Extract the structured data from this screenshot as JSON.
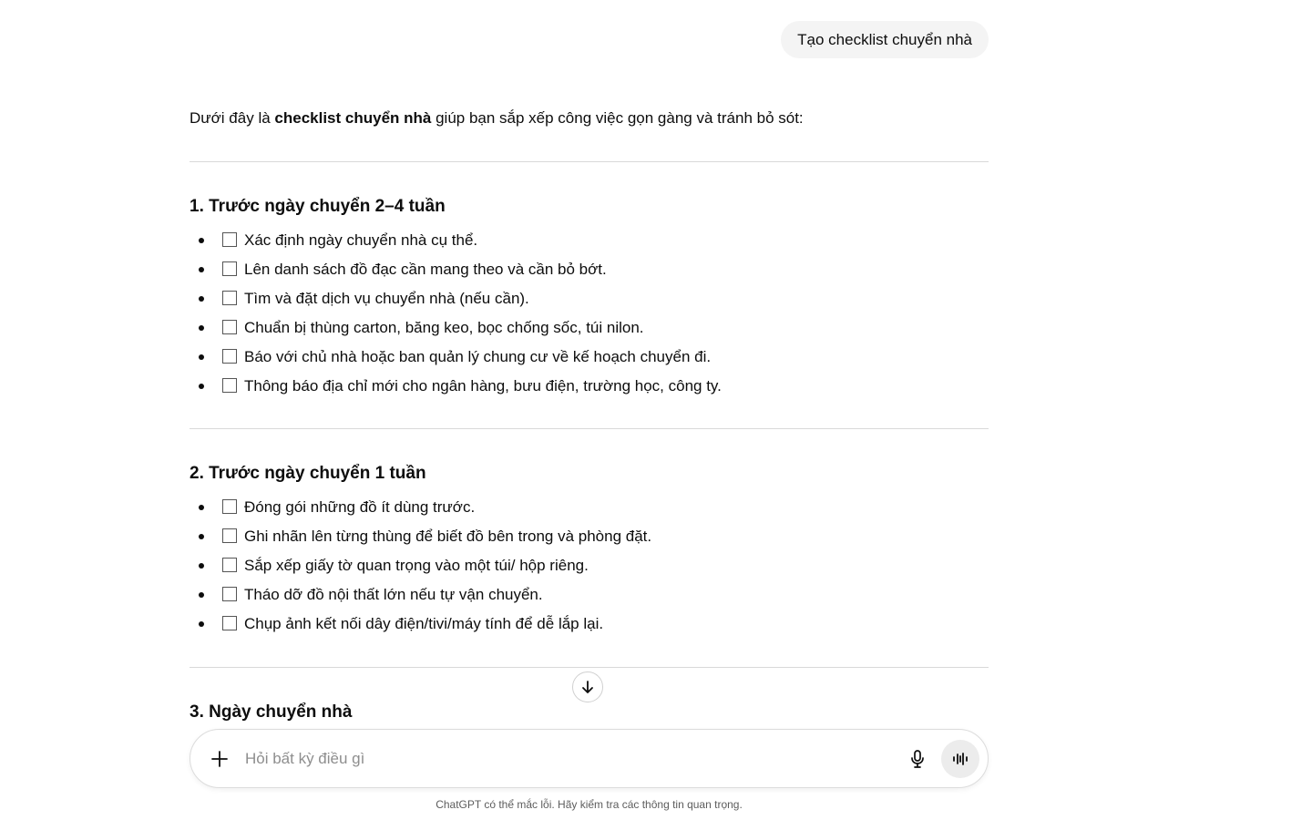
{
  "user_message": "Tạo checklist chuyển nhà",
  "intro": {
    "prefix": "Dưới đây là ",
    "bold": "checklist chuyển nhà",
    "suffix": " giúp bạn sắp xếp công việc gọn gàng và tránh bỏ sót:"
  },
  "sections": [
    {
      "title": "1. Trước ngày chuyển 2–4 tuần",
      "items": [
        "Xác định ngày chuyển nhà cụ thể.",
        "Lên danh sách đồ đạc cần mang theo và cần bỏ bớt.",
        "Tìm và đặt dịch vụ chuyển nhà (nếu cần).",
        "Chuẩn bị thùng carton, băng keo, bọc chống sốc, túi nilon.",
        "Báo với chủ nhà hoặc ban quản lý chung cư về kế hoạch chuyển đi.",
        "Thông báo địa chỉ mới cho ngân hàng, bưu điện, trường học, công ty."
      ]
    },
    {
      "title": "2. Trước ngày chuyển 1 tuần",
      "items": [
        "Đóng gói những đồ ít dùng trước.",
        "Ghi nhãn lên từng thùng để biết đồ bên trong và phòng đặt.",
        "Sắp xếp giấy tờ quan trọng vào một túi/ hộp riêng.",
        "Tháo dỡ đồ nội thất lớn nếu tự vận chuyển.",
        "Chụp ảnh kết nối dây điện/tivi/máy tính để dễ lắp lại."
      ]
    },
    {
      "title": "3. Ngày chuyển nhà",
      "items": []
    }
  ],
  "composer": {
    "placeholder": "Hỏi bất kỳ điều gì"
  },
  "disclaimer": "ChatGPT có thể mắc lỗi. Hãy kiểm tra các thông tin quan trọng.",
  "icons": {
    "add": "plus-icon",
    "mic": "microphone-icon",
    "voice": "voice-mode-icon",
    "scroll": "arrow-down-icon"
  }
}
